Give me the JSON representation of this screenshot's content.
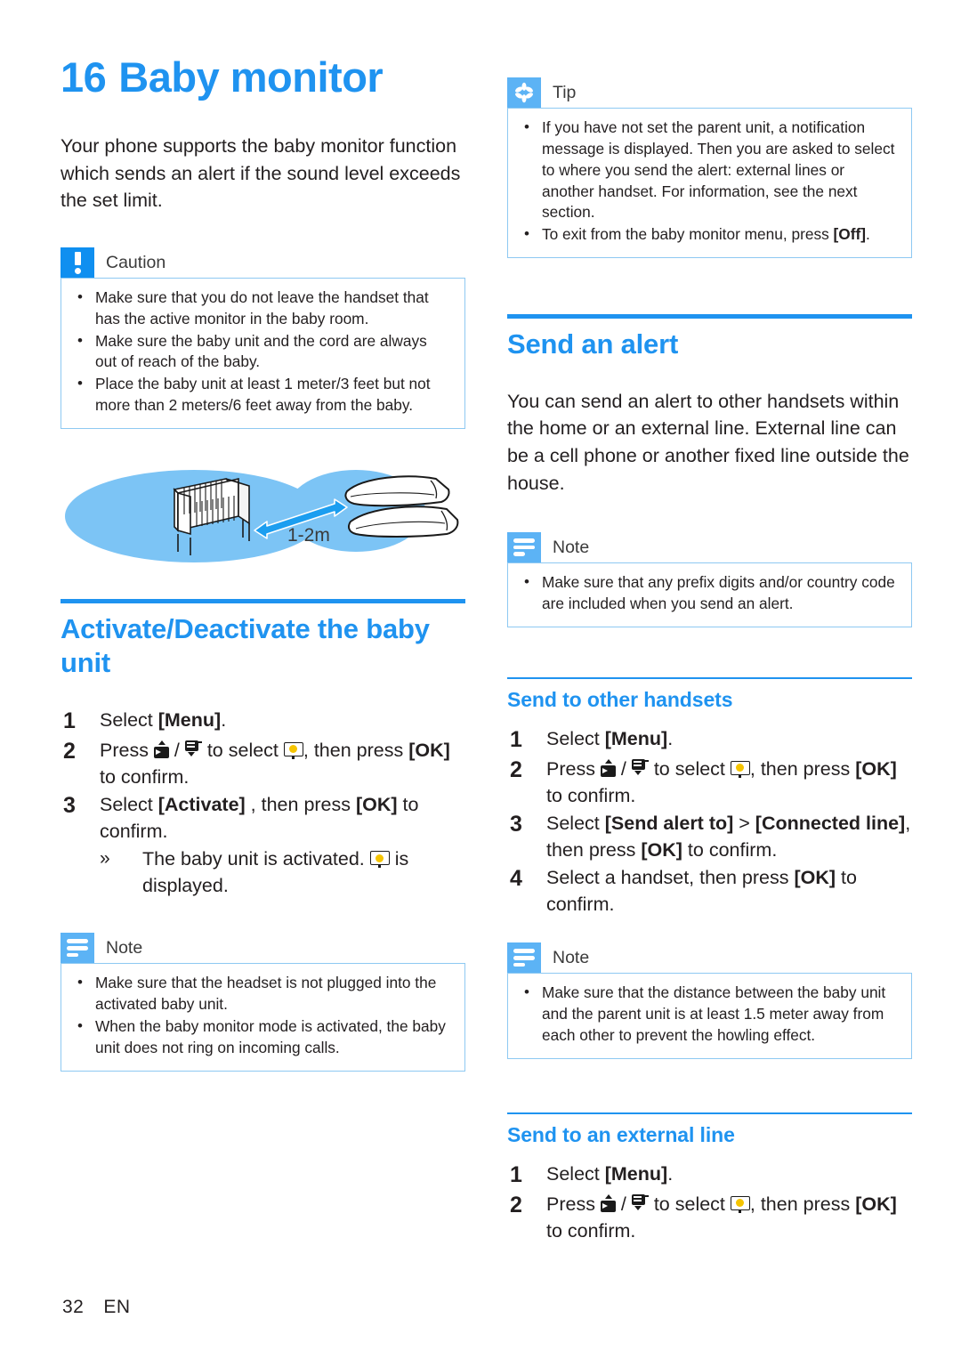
{
  "page": {
    "chapter_number": "16",
    "chapter_title": "Baby monitor",
    "footer_page": "32",
    "footer_lang": "EN",
    "accent_color": "#1f93f0",
    "badge_color": "#5cb3f5",
    "caution_badge_color": "#0f8ff0",
    "icon_yellow": "#f5c400"
  },
  "left": {
    "intro": "Your phone supports the baby monitor function which sends an alert if the sound level exceeds the set limit.",
    "caution": {
      "title": "Caution",
      "icon": "exclamation-icon",
      "items": [
        "Make sure that you do not leave the handset that has the active monitor in the baby room.",
        "Make sure the baby unit and the cord are always out of reach of the baby.",
        "Place the baby unit at least 1 meter/3 feet but not more than 2 meters/6 feet away from the baby."
      ]
    },
    "illustration": {
      "name": "baby-monitor-distance-illustration",
      "distance_label": "1-2m",
      "crib": "crib-icon",
      "handsets": "handset-pair-icon",
      "arrow": "double-arrow-icon"
    },
    "section": {
      "heading": "Activate/Deactivate the baby unit",
      "steps": [
        {
          "num": "1",
          "parts": [
            {
              "t": "text",
              "v": "Select "
            },
            {
              "t": "bold",
              "v": "[Menu]"
            },
            {
              "t": "text",
              "v": "."
            }
          ]
        },
        {
          "num": "2",
          "parts": [
            {
              "t": "text",
              "v": "Press "
            },
            {
              "t": "icon",
              "v": "key-up-icon"
            },
            {
              "t": "text",
              "v": " / "
            },
            {
              "t": "icon",
              "v": "key-down-icon"
            },
            {
              "t": "text",
              "v": " to select "
            },
            {
              "t": "icon",
              "v": "baby-monitor-icon"
            },
            {
              "t": "text",
              "v": ", then press "
            },
            {
              "t": "bold",
              "v": "[OK]"
            },
            {
              "t": "text",
              "v": " to confirm."
            }
          ]
        },
        {
          "num": "3",
          "parts": [
            {
              "t": "text",
              "v": "Select "
            },
            {
              "t": "bold",
              "v": "[Activate]"
            },
            {
              "t": "text",
              "v": " , then press "
            },
            {
              "t": "bold",
              "v": "[OK]"
            },
            {
              "t": "text",
              "v": " to confirm."
            }
          ],
          "substep": {
            "mark": "»",
            "parts": [
              {
                "t": "text",
                "v": "The baby unit is activated. "
              },
              {
                "t": "icon",
                "v": "baby-monitor-icon"
              },
              {
                "t": "text",
                "v": " is displayed."
              }
            ]
          }
        }
      ]
    },
    "note": {
      "title": "Note",
      "icon": "note-lines-icon",
      "items": [
        "Make sure that the headset is not plugged into the activated baby unit.",
        "When the baby monitor mode is activated, the baby unit does not ring on incoming calls."
      ]
    }
  },
  "right": {
    "tip": {
      "title": "Tip",
      "icon": "asterisk-icon",
      "items": [
        {
          "parts": [
            {
              "t": "text",
              "v": "If you have not set the parent unit, a notification message is displayed. Then you are asked to select to where you send the alert: external lines or another handset. For information, see the next section."
            }
          ]
        },
        {
          "parts": [
            {
              "t": "text",
              "v": "To exit from the baby monitor menu, press "
            },
            {
              "t": "bold",
              "v": "[Off]"
            },
            {
              "t": "text",
              "v": "."
            }
          ]
        }
      ]
    },
    "send_alert": {
      "heading": "Send an alert",
      "body": "You can send an alert to other handsets within the home or an external line. External line can be a cell phone or another fixed line outside the house.",
      "note": {
        "title": "Note",
        "icon": "note-lines-icon",
        "items": [
          "Make sure that any prefix digits and/or country code are included when you send an alert."
        ]
      }
    },
    "send_handsets": {
      "heading": "Send to other handsets",
      "steps": [
        {
          "num": "1",
          "parts": [
            {
              "t": "text",
              "v": "Select "
            },
            {
              "t": "bold",
              "v": "[Menu]"
            },
            {
              "t": "text",
              "v": "."
            }
          ]
        },
        {
          "num": "2",
          "parts": [
            {
              "t": "text",
              "v": "Press "
            },
            {
              "t": "icon",
              "v": "key-up-icon"
            },
            {
              "t": "text",
              "v": " / "
            },
            {
              "t": "icon",
              "v": "key-down-icon"
            },
            {
              "t": "text",
              "v": " to select "
            },
            {
              "t": "icon",
              "v": "baby-monitor-icon"
            },
            {
              "t": "text",
              "v": ", then press "
            },
            {
              "t": "bold",
              "v": "[OK]"
            },
            {
              "t": "text",
              "v": " to confirm."
            }
          ]
        },
        {
          "num": "3",
          "parts": [
            {
              "t": "text",
              "v": "Select "
            },
            {
              "t": "bold",
              "v": "[Send alert to]"
            },
            {
              "t": "text",
              "v": " > "
            },
            {
              "t": "bold",
              "v": "[Connected line]"
            },
            {
              "t": "text",
              "v": ", then press "
            },
            {
              "t": "bold",
              "v": "[OK]"
            },
            {
              "t": "text",
              "v": " to confirm."
            }
          ]
        },
        {
          "num": "4",
          "parts": [
            {
              "t": "text",
              "v": "Select a handset, then press "
            },
            {
              "t": "bold",
              "v": "[OK]"
            },
            {
              "t": "text",
              "v": " to confirm."
            }
          ]
        }
      ],
      "note": {
        "title": "Note",
        "icon": "note-lines-icon",
        "items": [
          "Make sure that the distance between the baby unit and the parent unit is at least 1.5 meter away from each other to prevent the howling effect."
        ]
      }
    },
    "send_external": {
      "heading": "Send to an external line",
      "steps": [
        {
          "num": "1",
          "parts": [
            {
              "t": "text",
              "v": "Select "
            },
            {
              "t": "bold",
              "v": "[Menu]"
            },
            {
              "t": "text",
              "v": "."
            }
          ]
        },
        {
          "num": "2",
          "parts": [
            {
              "t": "text",
              "v": "Press "
            },
            {
              "t": "icon",
              "v": "key-up-icon"
            },
            {
              "t": "text",
              "v": " / "
            },
            {
              "t": "icon",
              "v": "key-down-icon"
            },
            {
              "t": "text",
              "v": " to select "
            },
            {
              "t": "icon",
              "v": "baby-monitor-icon"
            },
            {
              "t": "text",
              "v": ", then press "
            },
            {
              "t": "bold",
              "v": "[OK]"
            },
            {
              "t": "text",
              "v": " to confirm."
            }
          ]
        }
      ]
    }
  }
}
